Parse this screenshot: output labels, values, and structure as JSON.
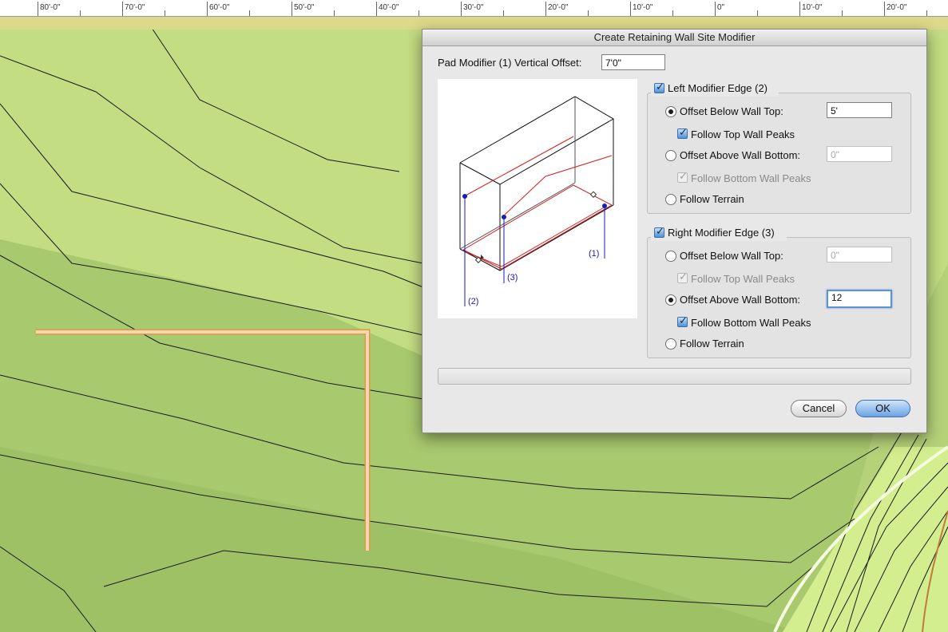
{
  "ruler": {
    "labels": [
      "80'-0\"",
      "70'-0\"",
      "60'-0\"",
      "50'-0\"",
      "40'-0\"",
      "30'-0\"",
      "20'-0\"",
      "10'-0\"",
      "0\"",
      "10'-0\"",
      "20'-0\""
    ]
  },
  "dialog": {
    "title": "Create Retaining Wall Site Modifier",
    "pad_offset_label": "Pad Modifier (1) Vertical Offset:",
    "pad_offset_value": "7'0\"",
    "left_edge": {
      "label": "Left Modifier Edge (2)",
      "checked": true,
      "offset_below_top_label": "Offset Below Wall Top:",
      "offset_below_top_value": "5'",
      "follow_top_peaks_label": "Follow Top Wall Peaks",
      "offset_above_bottom_label": "Offset Above Wall Bottom:",
      "offset_above_bottom_value": "0\"",
      "follow_bottom_peaks_label": "Follow Bottom Wall Peaks",
      "follow_terrain_label": "Follow Terrain"
    },
    "right_edge": {
      "label": "Right Modifier Edge (3)",
      "checked": true,
      "offset_below_top_label": "Offset Below Wall Top:",
      "offset_below_top_value": "0\"",
      "follow_top_peaks_label": "Follow Top Wall Peaks",
      "offset_above_bottom_label": "Offset Above Wall Bottom:",
      "offset_above_bottom_value": "12",
      "follow_bottom_peaks_label": "Follow Bottom Wall Peaks",
      "follow_terrain_label": "Follow Terrain"
    },
    "diagram_labels": {
      "pad": "(1)",
      "left": "(2)",
      "right": "(3)"
    },
    "cancel_label": "Cancel",
    "ok_label": "OK"
  },
  "colors": {
    "terrain": "#b9d67a",
    "wall": "#f2c48a",
    "accent": "#4f8fd6",
    "diagram_red": "#d22020",
    "diagram_blue": "#1a1ab8"
  }
}
